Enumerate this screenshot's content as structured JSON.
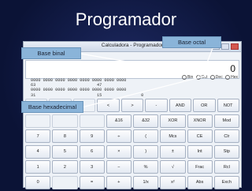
{
  "slide": {
    "title": "Programador"
  },
  "window": {
    "title": "Calculadora - Programador"
  },
  "display": {
    "value": "0"
  },
  "radios": [
    "Bin",
    "Oct",
    "Dec",
    "Hex"
  ],
  "bits": {
    "row1": "0000 0000 0000 0000 0000 0000 0000 0000",
    "row1_pos": "63                         47",
    "row2": "0000 0000 0000 0000 0000 0000 0000 0000",
    "row2_pos": "31                         15                0"
  },
  "keypad": [
    [
      "",
      "",
      "",
      "<",
      ">",
      "-",
      "AND",
      "OR",
      "NOT"
    ],
    [
      "",
      "",
      "",
      "&16",
      "&32",
      "XOR",
      "XNOR",
      "Mod"
    ],
    [
      "7",
      "8",
      "9",
      "÷",
      "(",
      "Mcs",
      "CE",
      "Clr"
    ],
    [
      "4",
      "5",
      "6",
      "×",
      ")",
      "±",
      "Int",
      "Stp"
    ],
    [
      "1",
      "2",
      "3",
      "−",
      "%",
      "√",
      "Frac",
      "Rcl"
    ],
    [
      "0",
      "",
      "=",
      "+",
      "1/x",
      "x²",
      "Abs",
      "Exch"
    ]
  ],
  "callouts": {
    "binario": "Base binal",
    "octal": "Base octal",
    "hexadecimal": "Base hexadecimal"
  },
  "colors": {
    "background": "#0b1336",
    "callout": "#8ab4d9",
    "arrow": "#ffffff"
  }
}
